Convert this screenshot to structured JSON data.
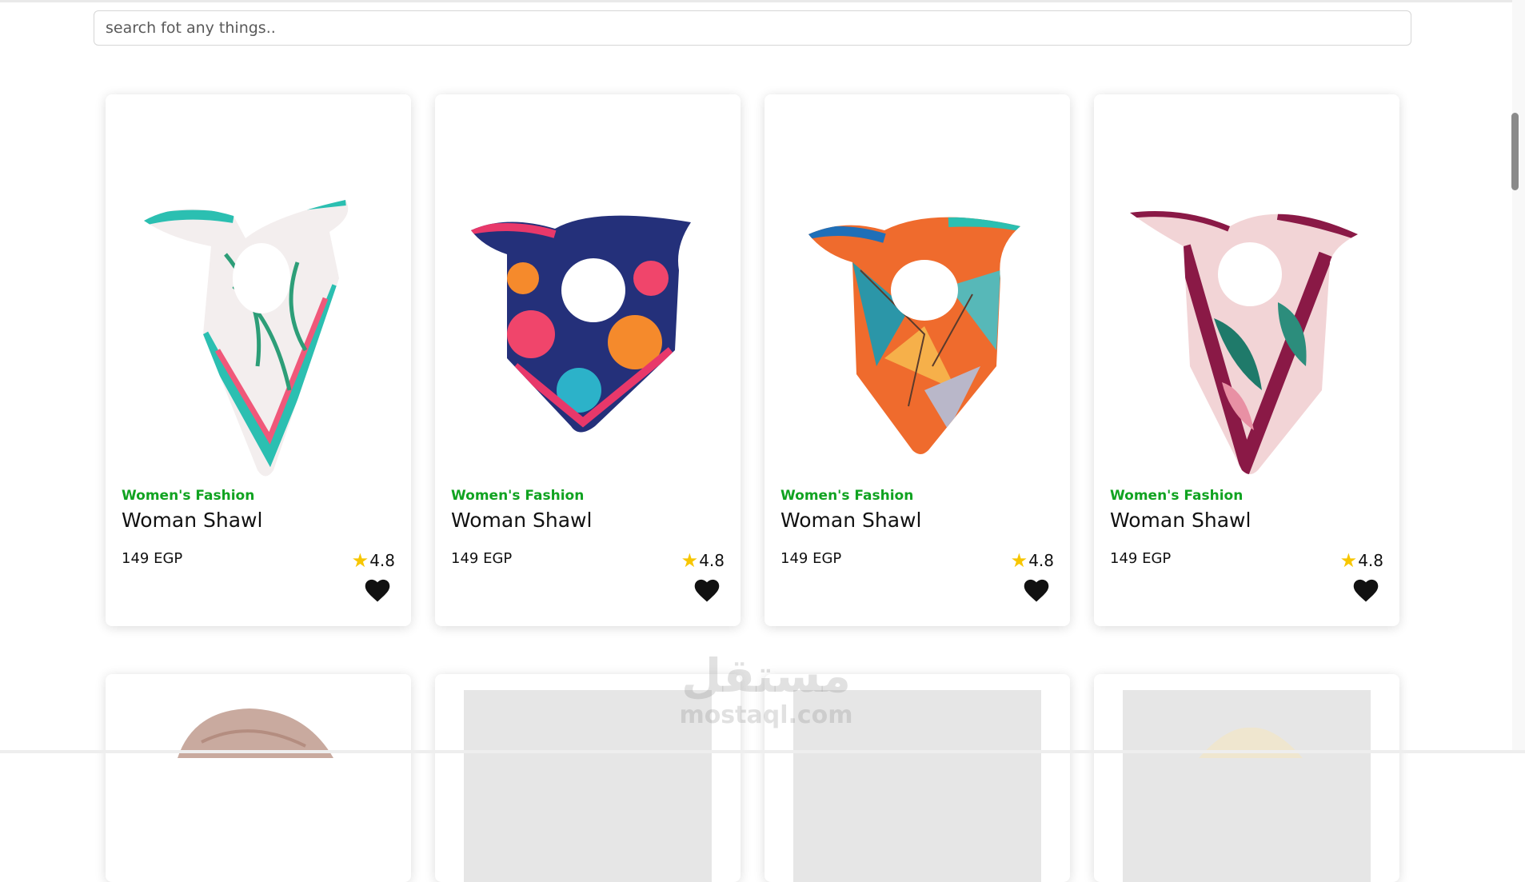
{
  "search": {
    "placeholder": "search fot any things.."
  },
  "products": [
    {
      "category": "Women's Fashion",
      "name": "Woman Shawl",
      "price": "149 EGP",
      "rating": "4.8",
      "image": "scarf-1"
    },
    {
      "category": "Women's Fashion",
      "name": "Woman Shawl",
      "price": "149 EGP",
      "rating": "4.8",
      "image": "scarf-2"
    },
    {
      "category": "Women's Fashion",
      "name": "Woman Shawl",
      "price": "149 EGP",
      "rating": "4.8",
      "image": "scarf-3"
    },
    {
      "category": "Women's Fashion",
      "name": "Woman Shawl",
      "price": "149 EGP",
      "rating": "4.8",
      "image": "scarf-4"
    }
  ],
  "icons": {
    "rating": "star-icon",
    "favorite": "heart-icon"
  },
  "colors": {
    "category": "#11a321",
    "star": "#f7c600",
    "heart": "#111111"
  },
  "watermark": {
    "arabic": "مستقل",
    "latin": "mostaql.com"
  }
}
